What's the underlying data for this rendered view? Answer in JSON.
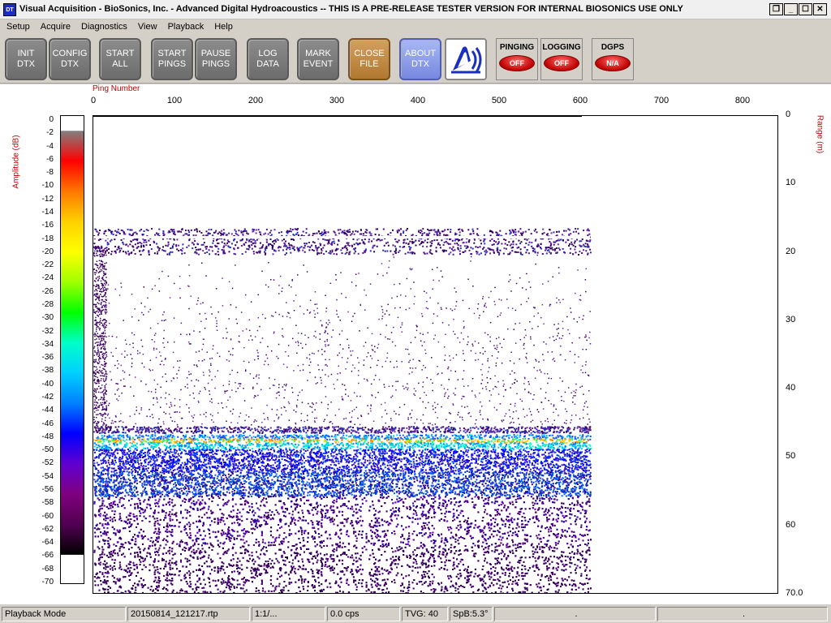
{
  "window": {
    "title": "Visual Acquisition  -  BioSonics, Inc.  -  Advanced Digital Hydroacoustics  -- THIS IS A PRE-RELEASE TESTER VERSION FOR INTERNAL BIOSONICS USE ONLY",
    "icon_text": "DT",
    "controls": [
      "❐",
      "_",
      "☐",
      "✕"
    ]
  },
  "menu": [
    "Setup",
    "Acquire",
    "Diagnostics",
    "View",
    "Playback",
    "Help"
  ],
  "toolbar": {
    "init": "INIT\nDTX",
    "config": "CONFIG\nDTX",
    "start_all": "START\nALL",
    "start_pings": "START\nPINGS",
    "pause_pings": "PAUSE\nPINGS",
    "log_data": "LOG\nDATA",
    "mark_event": "MARK\nEVENT",
    "close_file": "CLOSE\nFILE",
    "about": "ABOUT\nDTX",
    "logo_icon": "biosonics-logo-icon",
    "pinging_label": "PINGING",
    "pinging_value": "OFF",
    "logging_label": "LOGGING",
    "logging_value": "OFF",
    "dgps_label": "DGPS",
    "dgps_value": "N/A"
  },
  "plot": {
    "ping_axis_title": "Ping Number",
    "amp_axis_title": "Amplitude (dB)",
    "range_axis_title": "Range (m)",
    "ping_ticks": [
      "0",
      "100",
      "200",
      "300",
      "400",
      "500",
      "600",
      "700",
      "800"
    ],
    "range_ticks": [
      "0",
      "10",
      "20",
      "30",
      "40",
      "50",
      "60",
      "70.0"
    ],
    "amp_ticks": [
      "0",
      "-2",
      "-4",
      "-6",
      "-8",
      "-10",
      "-12",
      "-14",
      "-16",
      "-18",
      "-20",
      "-22",
      "-24",
      "-26",
      "-28",
      "-30",
      "-32",
      "-34",
      "-36",
      "-38",
      "-40",
      "-42",
      "-44",
      "-46",
      "-48",
      "-50",
      "-52",
      "-54",
      "-56",
      "-58",
      "-60",
      "-62",
      "-64",
      "-66",
      "-68",
      "-70"
    ],
    "colors": {
      "axis_title": "#c00000",
      "colormap": [
        "#808080",
        "#ff0000",
        "#ff7800",
        "#ffd000",
        "#ffff00",
        "#a0ff00",
        "#00ff00",
        "#00ffc8",
        "#00d0ff",
        "#0080ff",
        "#0000ff",
        "#6000d0",
        "#800080",
        "#500050",
        "#000000"
      ]
    }
  },
  "status": {
    "mode": "Playback Mode",
    "file": "20150814_121217.rtp",
    "ratio": "1:1/...",
    "rate": "0.0 cps",
    "tvg": "TVG: 40",
    "spb": "SpB:5.3°",
    "extra1": ".",
    "extra2": "."
  }
}
